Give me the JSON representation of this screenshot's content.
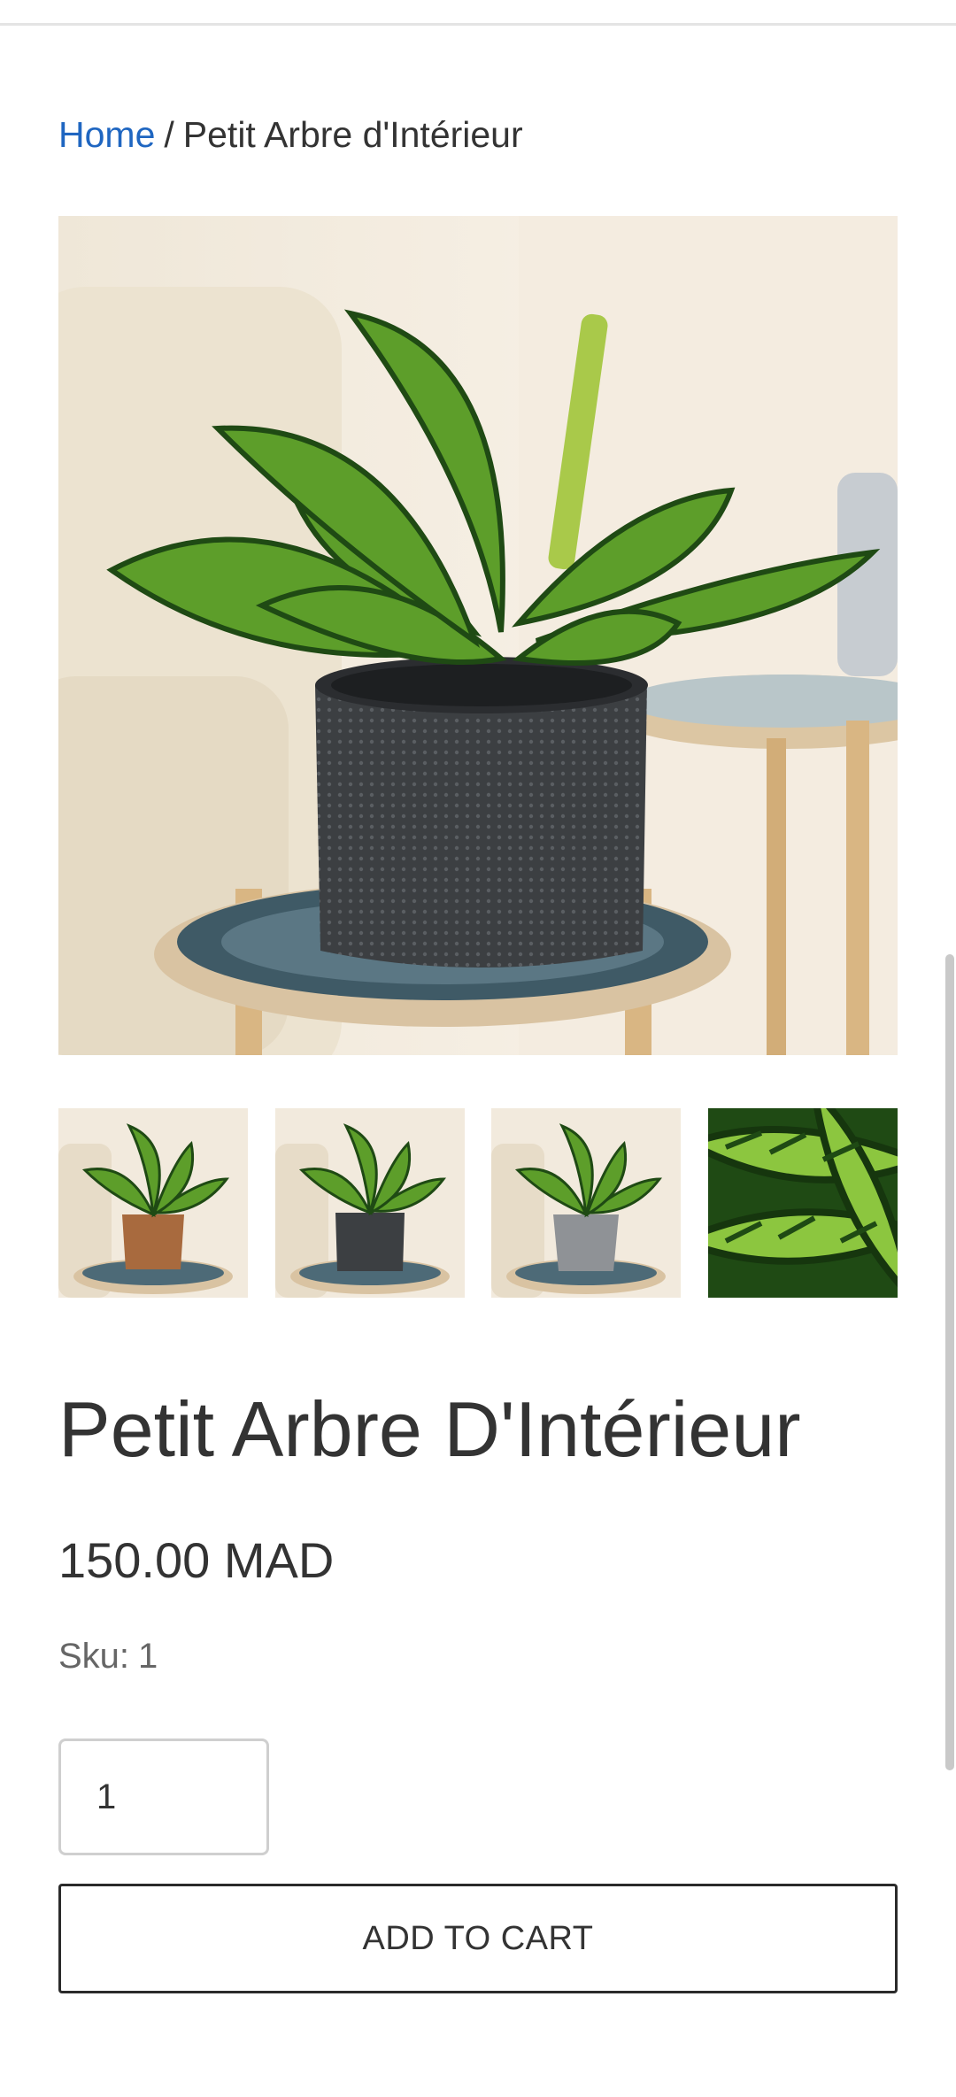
{
  "breadcrumb": {
    "home_label": "Home",
    "separator": "/",
    "current_label": "Petit Arbre d'Intérieur"
  },
  "gallery": {
    "main_image": {
      "pot_color": "#3c3f42"
    },
    "thumbnails": [
      {
        "pot_color": "#a86a3e"
      },
      {
        "pot_color": "#3c3f42"
      },
      {
        "pot_color": "#8f9296"
      },
      {
        "pot_color": "leaf-closeup"
      }
    ]
  },
  "product": {
    "title": "Petit Arbre D'Intérieur",
    "price": "150.00 MAD",
    "sku_label": "Sku:",
    "sku_value": "1",
    "quantity": "1"
  },
  "actions": {
    "add_to_cart_label": "ADD TO CART"
  },
  "colors": {
    "link": "#1f66c1",
    "text": "#333333",
    "muted": "#666666"
  }
}
